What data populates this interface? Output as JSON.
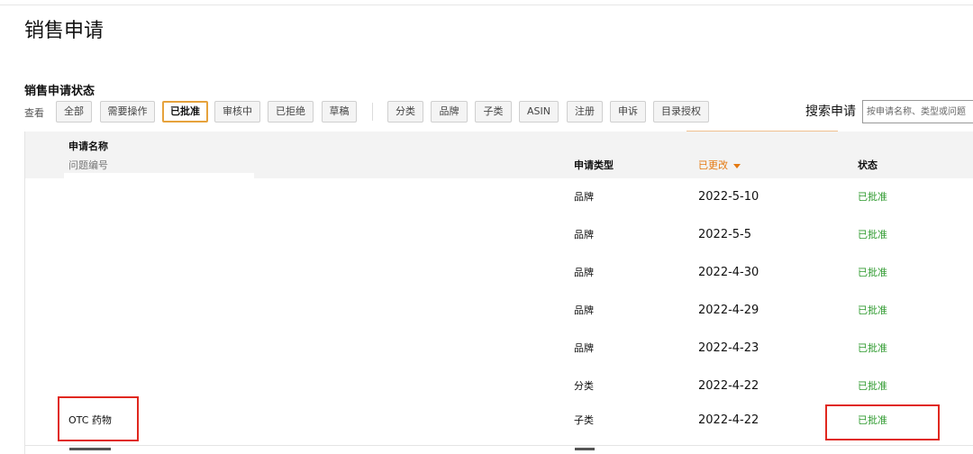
{
  "page_title": "销售申请",
  "section_title": "销售申请状态",
  "filters": {
    "label": "查看",
    "status_buttons": [
      "全部",
      "需要操作",
      "已批准",
      "审核中",
      "已拒绝",
      "草稿"
    ],
    "type_buttons": [
      "分类",
      "品牌",
      "子类",
      "ASIN",
      "注册",
      "申诉",
      "目录授权"
    ],
    "active": "已批准"
  },
  "search": {
    "label": "搜索申请",
    "placeholder": "按申请名称、类型或问题"
  },
  "table": {
    "headers": {
      "name": "申请名称",
      "issue_number": "问题编号",
      "type": "申请类型",
      "modified": "已更改",
      "status": "状态"
    },
    "rows": [
      {
        "name": "",
        "type": "品牌",
        "date": "2022-5-10",
        "status": "已批准"
      },
      {
        "name": "",
        "type": "品牌",
        "date": "2022-5-5",
        "status": "已批准"
      },
      {
        "name": "",
        "type": "品牌",
        "date": "2022-4-30",
        "status": "已批准"
      },
      {
        "name": "",
        "type": "品牌",
        "date": "2022-4-29",
        "status": "已批准"
      },
      {
        "name": "",
        "type": "品牌",
        "date": "2022-4-23",
        "status": "已批准"
      },
      {
        "name": "",
        "type": "分类",
        "date": "2022-4-22",
        "status": "已批准"
      },
      {
        "name": "OTC 药物",
        "type": "子类",
        "date": "2022-4-22",
        "status": "已批准"
      }
    ]
  },
  "colors": {
    "accent_orange": "#e47911",
    "active_border": "#e6a23c",
    "status_green": "#2e9a2e",
    "highlight_red": "#e0281f"
  }
}
